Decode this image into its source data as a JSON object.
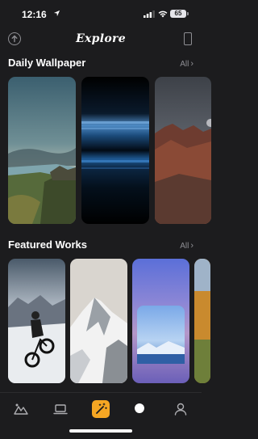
{
  "status_bar": {
    "time": "12:16",
    "battery": "65"
  },
  "header": {
    "title": "Explore"
  },
  "sections": [
    {
      "title": "Daily Wallpaper",
      "all_label": "All"
    },
    {
      "title": "Featured Works",
      "all_label": "All"
    }
  ],
  "tabs": [
    {
      "icon": "landscape-icon"
    },
    {
      "icon": "laptop-icon"
    },
    {
      "icon": "magic-wand-icon",
      "active": true
    },
    {
      "icon": "search-icon"
    },
    {
      "icon": "profile-icon"
    }
  ],
  "colors": {
    "accent": "#f5a623",
    "background": "#1c1c1e",
    "secondary_text": "#8e8e93"
  }
}
